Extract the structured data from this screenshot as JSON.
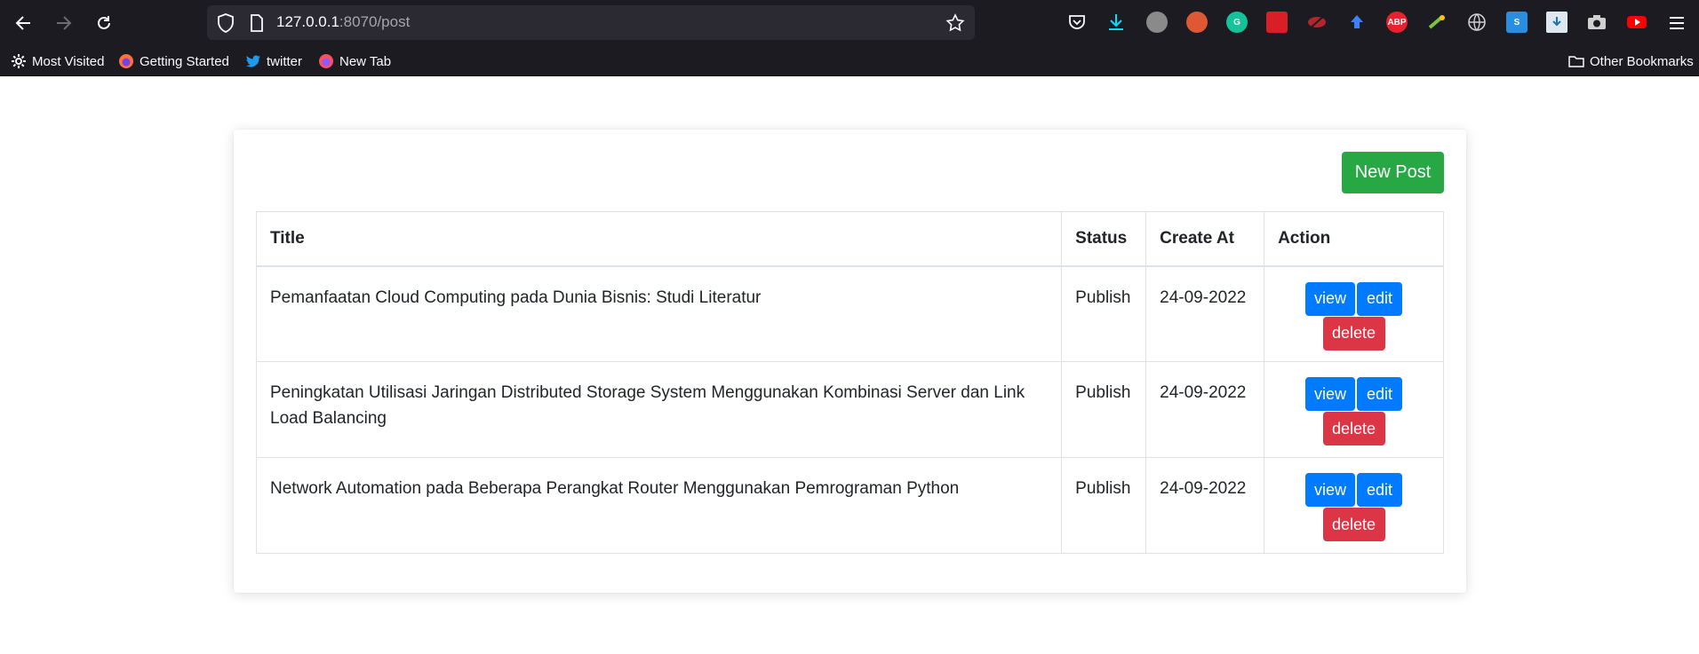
{
  "browser": {
    "url_host": "127.0.0.1",
    "url_path": ":8070/post",
    "bookmarks": [
      {
        "label": "Most Visited"
      },
      {
        "label": "Getting Started"
      },
      {
        "label": "twitter"
      },
      {
        "label": "New Tab"
      }
    ],
    "other_bookmarks": "Other Bookmarks",
    "extensions": [
      "pocket",
      "download",
      "avatar",
      "duckduckgo",
      "grammarly",
      "mendeley",
      "hide",
      "arrow",
      "adblock-plus",
      "colorzilla",
      "globe",
      "s-ext",
      "save",
      "camera",
      "youtube"
    ],
    "abp_label": "ABP",
    "s_label": "S"
  },
  "page": {
    "new_post_label": "New Post",
    "table": {
      "headers": [
        "Title",
        "Status",
        "Create At",
        "Action"
      ],
      "rows": [
        {
          "title": "Pemanfaatan Cloud Computing pada Dunia Bisnis: Studi Literatur",
          "status": "Publish",
          "created": "24-09-2022"
        },
        {
          "title": "Peningkatan Utilisasi Jaringan Distributed Storage System Menggunakan Kombinasi Server dan Link Load Balancing",
          "status": "Publish",
          "created": "24-09-2022"
        },
        {
          "title": "Network Automation pada Beberapa Perangkat Router Menggunakan Pemrograman Python",
          "status": "Publish",
          "created": "24-09-2022"
        }
      ]
    },
    "actions": {
      "view": "view",
      "edit": "edit",
      "delete": "delete"
    }
  },
  "colors": {
    "success": "#28a745",
    "primary": "#007bff",
    "danger": "#dc3545",
    "chrome": "#1c1b22"
  }
}
